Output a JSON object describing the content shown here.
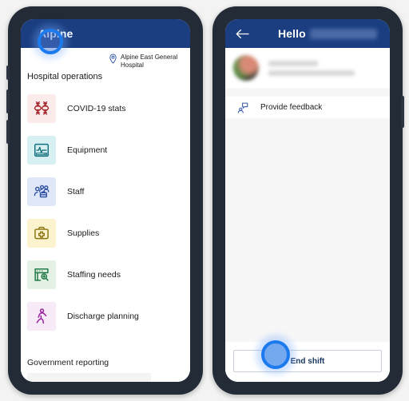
{
  "left_phone": {
    "appbar": {
      "title": "Alpine",
      "logo_icon": "app-logo-icon"
    },
    "location": {
      "icon": "location-pin-icon",
      "line1": "Alpine East General",
      "line2": "Hospital"
    },
    "section_title": "Hospital operations",
    "operations": [
      {
        "label": "COVID-19 stats",
        "icon": "virus-dna-icon",
        "tile_bg": "#fbeceb",
        "icon_color": "#a4262c"
      },
      {
        "label": "Equipment",
        "icon": "vital-monitor-icon",
        "tile_bg": "#d9f0f2",
        "icon_color": "#12707e"
      },
      {
        "label": "Staff",
        "icon": "people-team-icon",
        "tile_bg": "#dfe7f8",
        "icon_color": "#2b4fa2"
      },
      {
        "label": "Supplies",
        "icon": "first-aid-kit-icon",
        "tile_bg": "#fbf3cd",
        "icon_color": "#8a7412"
      },
      {
        "label": "Staffing needs",
        "icon": "board-search-icon",
        "tile_bg": "#e4f2e6",
        "icon_color": "#13703b"
      },
      {
        "label": "Discharge planning",
        "icon": "walking-person-icon",
        "tile_bg": "#f7ebf7",
        "icon_color": "#9a2aa0"
      }
    ],
    "footer": {
      "title": "Government reporting"
    }
  },
  "right_phone": {
    "appbar": {
      "back_icon": "back-arrow-icon",
      "greeting": "Hello",
      "name_redacted": true
    },
    "profile": {
      "avatar_icon": "user-avatar",
      "name_redacted": true,
      "subtitle_redacted": true
    },
    "feedback": {
      "label": "Provide  feedback",
      "icon": "feedback-person-icon"
    },
    "end_shift": {
      "label": "End shift"
    }
  },
  "cursors": [
    {
      "name": "click-indicator-left",
      "target": "app-logo"
    },
    {
      "name": "click-indicator-right",
      "target": "end-shift-button"
    }
  ],
  "colors": {
    "appbar_blue": "#1a3e80",
    "frame": "#222b36",
    "accent": "#1b7aee",
    "page_bg": "#f3f3f3"
  }
}
